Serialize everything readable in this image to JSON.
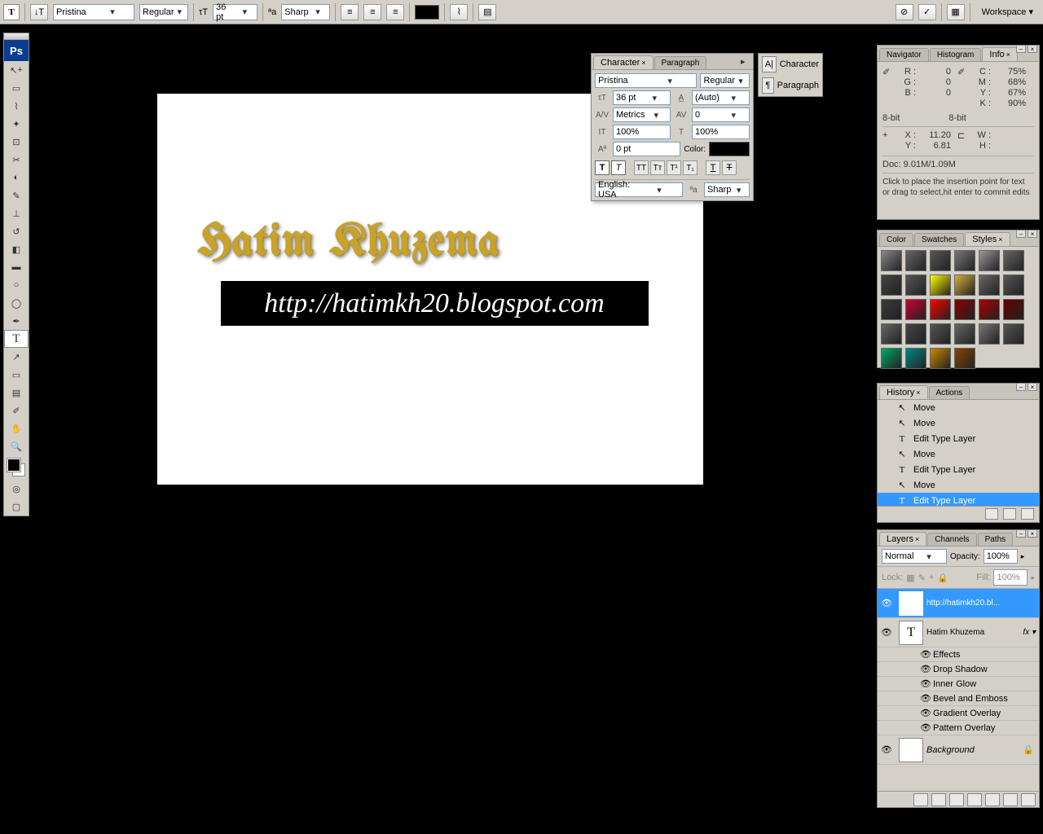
{
  "optionsBar": {
    "font": "Pristina",
    "weight": "Regular",
    "size": "36 pt",
    "antialias": "Sharp",
    "workspace": "Workspace ▾"
  },
  "canvas": {
    "goldText": "Hatim Khuzema",
    "urlText": "http://hatimkh20.blogspot.com"
  },
  "characterPanel": {
    "tabs": [
      "Character",
      "Paragraph"
    ],
    "font": "Pristina",
    "weight": "Regular",
    "size": "36 pt",
    "leading": "(Auto)",
    "kerning": "Metrics",
    "tracking": "0",
    "vscale": "100%",
    "hscale": "100%",
    "baseline": "0 pt",
    "colorLabel": "Color:",
    "language": "English: USA",
    "antialias": "Sharp"
  },
  "iconicPanel": {
    "items": [
      "Character",
      "Paragraph"
    ]
  },
  "infoPanel": {
    "tabs": [
      "Navigator",
      "Histogram",
      "Info"
    ],
    "rgb": {
      "R": "0",
      "G": "0",
      "B": "0"
    },
    "cmyk": {
      "C": "75%",
      "M": "68%",
      "Y": "67%",
      "K": "90%"
    },
    "mode1": "8-bit",
    "mode2": "8-bit",
    "xy": {
      "X": "11.20",
      "Y": "6.81"
    },
    "wh": {
      "W": "",
      "H": ""
    },
    "doc": "Doc: 9.01M/1.09M",
    "hint": "Click to place the insertion point for text or drag to select,hit enter to commit edits"
  },
  "stylesPanel": {
    "tabs": [
      "Color",
      "Swatches",
      "Styles"
    ],
    "swatches": [
      "#888",
      "#666",
      "#555",
      "#777",
      "#999",
      "#666",
      "#444",
      "#555",
      "#ff0",
      "#d4af37",
      "#666",
      "#555",
      "#3a3a3a",
      "#c03",
      "#f00",
      "#800",
      "#a00",
      "#600",
      "#666",
      "#444",
      "#555",
      "#666",
      "#777",
      "#555",
      "#0a6",
      "#088",
      "#c80",
      "#840",
      "#fff",
      "#fff"
    ]
  },
  "historyPanel": {
    "tabs": [
      "History",
      "Actions"
    ],
    "items": [
      {
        "icon": "↖",
        "label": "Move"
      },
      {
        "icon": "↖",
        "label": "Move"
      },
      {
        "icon": "T",
        "label": "Edit Type Layer"
      },
      {
        "icon": "↖",
        "label": "Move"
      },
      {
        "icon": "T",
        "label": "Edit Type Layer"
      },
      {
        "icon": "↖",
        "label": "Move"
      },
      {
        "icon": "T",
        "label": "Edit Type Layer",
        "active": true
      }
    ]
  },
  "layersPanel": {
    "tabs": [
      "Layers",
      "Channels",
      "Paths"
    ],
    "blend": "Normal",
    "opacityLabel": "Opacity:",
    "opacity": "100%",
    "lockLabel": "Lock:",
    "fillLabel": "Fill:",
    "fill": "100%",
    "layers": [
      {
        "name": "http://hatimkh20.bl...",
        "type": "T",
        "active": true
      },
      {
        "name": "Hatim Khuzema",
        "type": "T",
        "fx": true
      },
      {
        "name": "Background",
        "type": "bg",
        "locked": true
      }
    ],
    "effects": [
      "Effects",
      "Drop Shadow",
      "Inner Glow",
      "Bevel and Emboss",
      "Gradient Overlay",
      "Pattern Overlay"
    ]
  }
}
